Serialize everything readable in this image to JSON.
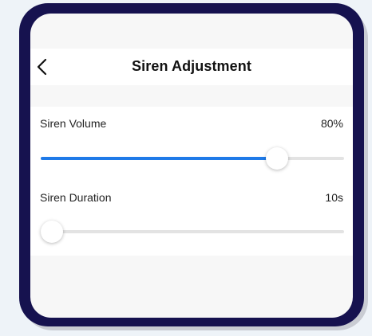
{
  "header": {
    "title": "Siren Adjustment",
    "back_icon": "chevron-left-icon"
  },
  "settings": {
    "volume": {
      "label": "Siren Volume",
      "value_text": "80%",
      "level": 0.78
    },
    "duration": {
      "label": "Siren Duration",
      "value_text": "10s",
      "level": 0.0
    }
  },
  "colors": {
    "accent": "#1f7ae8",
    "frame": "#16124f",
    "track": "#e3e3e3"
  }
}
